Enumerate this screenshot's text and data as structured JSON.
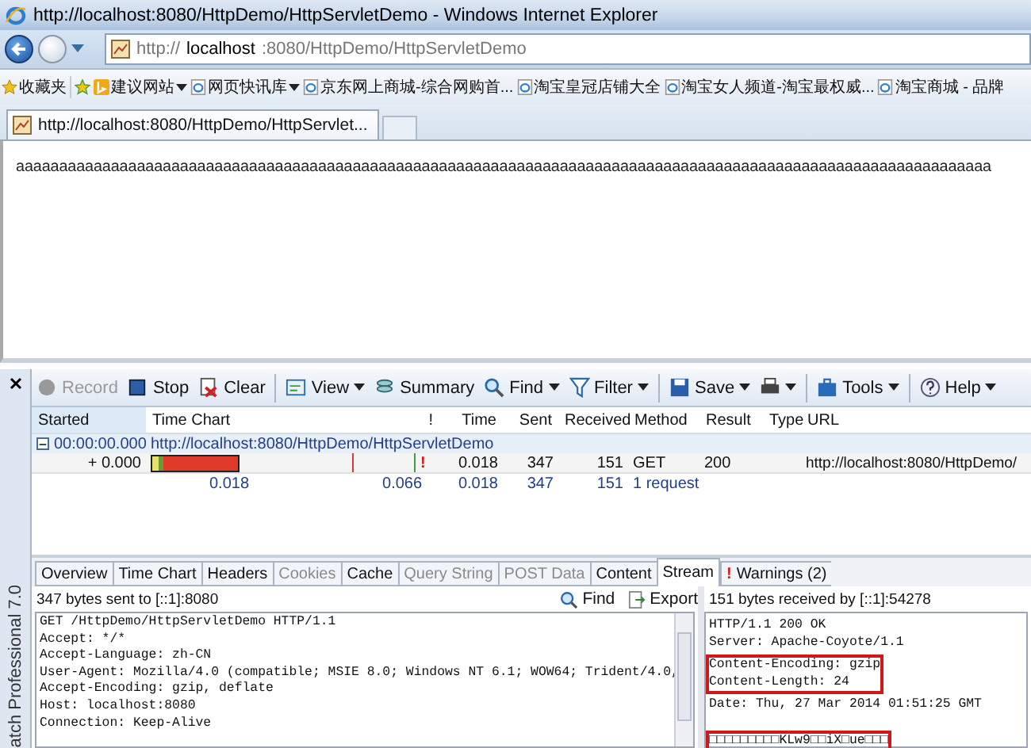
{
  "window": {
    "title": "http://localhost:8080/HttpDemo/HttpServletDemo - Windows Internet Explorer"
  },
  "address_bar": {
    "prefix": "http://",
    "host": "localhost",
    "rest": ":8080/HttpDemo/HttpServletDemo"
  },
  "favorites_bar": {
    "label": "收藏夹",
    "items": [
      {
        "label": "建议网站",
        "kind": "bing",
        "dropdown": true
      },
      {
        "label": "网页快讯库",
        "kind": "page",
        "dropdown": true
      },
      {
        "label": "京东网上商城-综合网购首...",
        "kind": "page",
        "dropdown": false
      },
      {
        "label": "淘宝皇冠店铺大全",
        "kind": "page",
        "dropdown": false
      },
      {
        "label": "淘宝女人频道-淘宝最权威...",
        "kind": "page",
        "dropdown": false
      },
      {
        "label": "淘宝商城 - 品牌",
        "kind": "page",
        "dropdown": false
      }
    ]
  },
  "tab": {
    "title": "http://localhost:8080/HttpDemo/HttpServlet..."
  },
  "page": {
    "text": "aaaaaaaaaaaaaaaaaaaaaaaaaaaaaaaaaaaaaaaaaaaaaaaaaaaaaaaaaaaaaaaaaaaaaaaaaaaaaaaaaaaaaaaaaaaaaaaaaaaaaaaaaaaaaaaaa"
  },
  "httpwatch": {
    "sidebar_title": "atch Professional 7.0",
    "toolbar_groups": [
      [
        {
          "label": "Record",
          "kind": "record",
          "disabled": true,
          "dropdown": false
        },
        {
          "label": "Stop",
          "kind": "stop",
          "disabled": false,
          "dropdown": false
        },
        {
          "label": "Clear",
          "kind": "clear",
          "disabled": false,
          "dropdown": false
        }
      ],
      [
        {
          "label": "View",
          "kind": "view",
          "disabled": false,
          "dropdown": true
        },
        {
          "label": "Summary",
          "kind": "summary",
          "disabled": false,
          "dropdown": false
        },
        {
          "label": "Find",
          "kind": "find",
          "disabled": false,
          "dropdown": true
        },
        {
          "label": "Filter",
          "kind": "filter",
          "disabled": false,
          "dropdown": true
        }
      ],
      [
        {
          "label": "Save",
          "kind": "save",
          "disabled": false,
          "dropdown": true
        },
        {
          "kind": "printer",
          "disabled": false,
          "dropdown": true
        }
      ],
      [
        {
          "label": "Tools",
          "kind": "tools",
          "disabled": false,
          "dropdown": true
        }
      ],
      [
        {
          "label": "Help",
          "kind": "help",
          "disabled": false,
          "dropdown": true
        }
      ]
    ],
    "columns": [
      "Started",
      "Time Chart",
      "!",
      "Time",
      "Sent",
      "Received",
      "Method",
      "Result",
      "Type",
      "URL"
    ],
    "rows": [
      {
        "kind": "group",
        "expanded": true,
        "started": "00:00:00.000",
        "url": "http://localhost:8080/HttpDemo/HttpServletDemo"
      },
      {
        "kind": "entry",
        "started": "+ 0.000",
        "warning": "!",
        "time": "0.018",
        "sent": "347",
        "received": "151",
        "method": "GET",
        "result": "200",
        "url": "http://localhost:8080/HttpDemo/"
      },
      {
        "kind": "summary",
        "chart_start": "0.018",
        "chart_end": "0.066",
        "time": "0.018",
        "sent": "347",
        "received": "151",
        "method": "1 request"
      }
    ],
    "detail_tabs": [
      {
        "label": "Overview",
        "selected": false,
        "disabled": false
      },
      {
        "label": "Time Chart",
        "selected": false,
        "disabled": false
      },
      {
        "label": "Headers",
        "selected": false,
        "disabled": false
      },
      {
        "label": "Cookies",
        "selected": false,
        "disabled": true
      },
      {
        "label": "Cache",
        "selected": false,
        "disabled": false
      },
      {
        "label": "Query String",
        "selected": false,
        "disabled": true
      },
      {
        "label": "POST Data",
        "selected": false,
        "disabled": true
      },
      {
        "label": "Content",
        "selected": false,
        "disabled": false
      },
      {
        "label": "Stream",
        "selected": true,
        "disabled": false
      },
      {
        "label": "Warnings (2)",
        "mark": "!",
        "selected": false,
        "disabled": false
      }
    ],
    "request": {
      "info": "347 bytes sent to [::1]:8080",
      "find": "Find",
      "export": "Export",
      "lines": [
        "GET /HttpDemo/HttpServletDemo HTTP/1.1",
        "Accept: */*",
        "Accept-Language: zh-CN",
        "User-Agent: Mozilla/4.0 (compatible; MSIE 8.0; Windows NT 6.1; WOW64; Trident/4.0,",
        "Accept-Encoding: gzip, deflate",
        "Host: localhost:8080",
        "Connection: Keep-Alive"
      ]
    },
    "response": {
      "info": "151 bytes received by [::1]:54278",
      "blocks": [
        {
          "highlighted": false,
          "lines": [
            "HTTP/1.1 200 OK",
            "Server: Apache-Coyote/1.1"
          ]
        },
        {
          "highlighted": true,
          "lines": [
            "Content-Encoding: gzip",
            "Content-Length: 24"
          ]
        },
        {
          "highlighted": false,
          "lines": [
            "Date: Thu, 27 Mar 2014 01:51:25 GMT"
          ]
        },
        {
          "highlighted": true,
          "lines": [
            "□□□□□□□□□KLw9□□iX□ue□□□"
          ]
        }
      ]
    }
  }
}
